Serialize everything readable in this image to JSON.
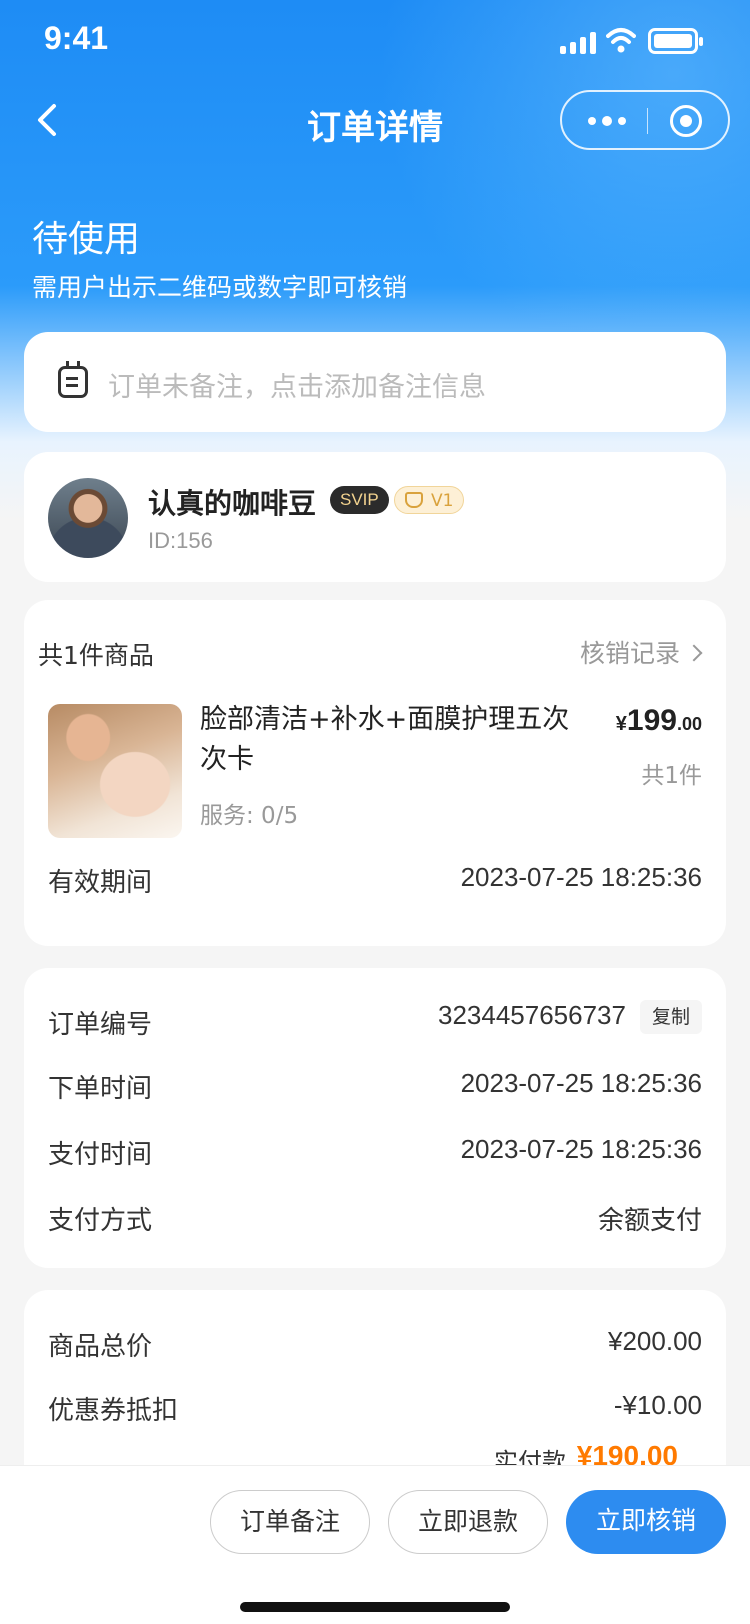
{
  "status_bar": {
    "time": "9:41"
  },
  "nav": {
    "title": "订单详情"
  },
  "order_status": {
    "title": "待使用",
    "subtitle": "需用户出示二维码或数字即可核销"
  },
  "remark": {
    "placeholder": "订单未备注，点击添加备注信息"
  },
  "user": {
    "name": "认真的咖啡豆",
    "svip_badge": "SVIP",
    "level_badge": "V1",
    "id": "ID:156"
  },
  "goods": {
    "count_label": "共1件商品",
    "record_link": "核销记录",
    "name": "脸部清洁+补水+面膜护理五次次卡",
    "service": "服务: 0/5",
    "price_symbol": "¥",
    "price_int": "199",
    "price_dec": ".00",
    "quantity": "共1件",
    "validity_label": "有效期间",
    "validity_value": "2023-07-25 18:25:36"
  },
  "order_info": {
    "order_no_label": "订单编号",
    "order_no_value": "3234457656737",
    "copy_label": "复制",
    "order_time_label": "下单时间",
    "order_time_value": "2023-07-25 18:25:36",
    "pay_time_label": "支付时间",
    "pay_time_value": "2023-07-25 18:25:36",
    "pay_method_label": "支付方式",
    "pay_method_value": "余额支付"
  },
  "price_info": {
    "total_label": "商品总价",
    "total_value": "¥200.00",
    "coupon_label": "优惠券抵扣",
    "coupon_value": "-¥10.00",
    "partially_hidden_label": "实付款",
    "partially_hidden_value": "¥190.00"
  },
  "actions": {
    "remark_button": "订单备注",
    "refund_button": "立即退款",
    "verify_button": "立即核销"
  },
  "colors": {
    "primary": "#2d8cf0",
    "header_gradient_top": "#1e8cf5",
    "accent_orange": "#ff7a00"
  }
}
